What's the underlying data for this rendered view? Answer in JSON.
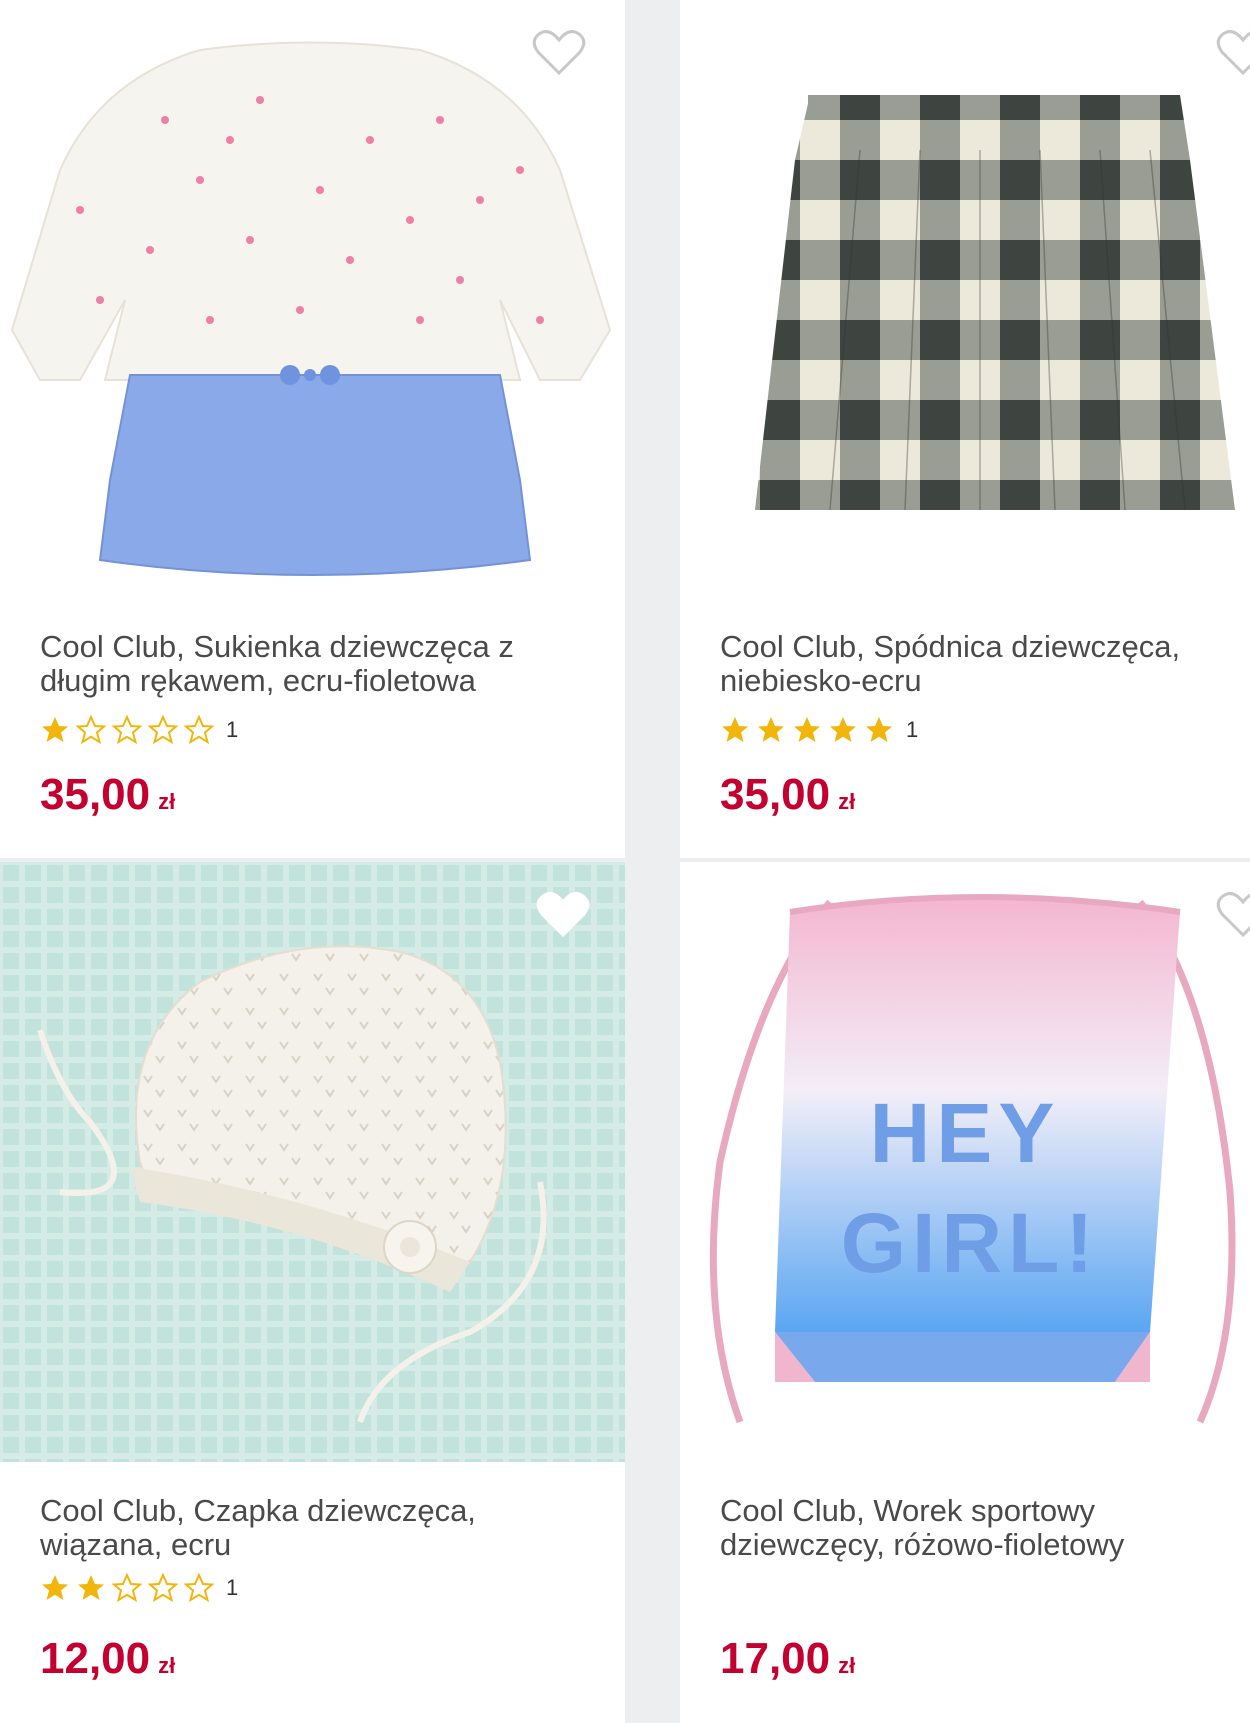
{
  "colors": {
    "accent_price": "#c3002f",
    "star_gold": "#f2b50c",
    "background": "#eceef0"
  },
  "products": [
    {
      "title": "Cool Club, Sukienka dziewczęca z długim rękawem, ecru-fioletowa",
      "stars": 1,
      "rating_count": "1",
      "price": "35,00",
      "currency": "zł",
      "image_icon": "dress-image"
    },
    {
      "title": "Cool Club, Spódnica dziewczęca, niebiesko-ecru",
      "stars": 5,
      "rating_count": "1",
      "price": "35,00",
      "currency": "zł",
      "image_icon": "skirt-image"
    },
    {
      "title": "Cool Club, Czapka dziewczęca, wiązana, ecru",
      "stars": 2,
      "rating_count": "1",
      "price": "12,00",
      "currency": "zł",
      "image_icon": "hat-image"
    },
    {
      "title": "Cool Club, Worek sportowy dziewczęcy, różowo-fioletowy",
      "stars": 0,
      "rating_count": "",
      "price": "17,00",
      "currency": "zł",
      "image_icon": "bag-image",
      "bag_print": "HEY GIRL!"
    }
  ]
}
